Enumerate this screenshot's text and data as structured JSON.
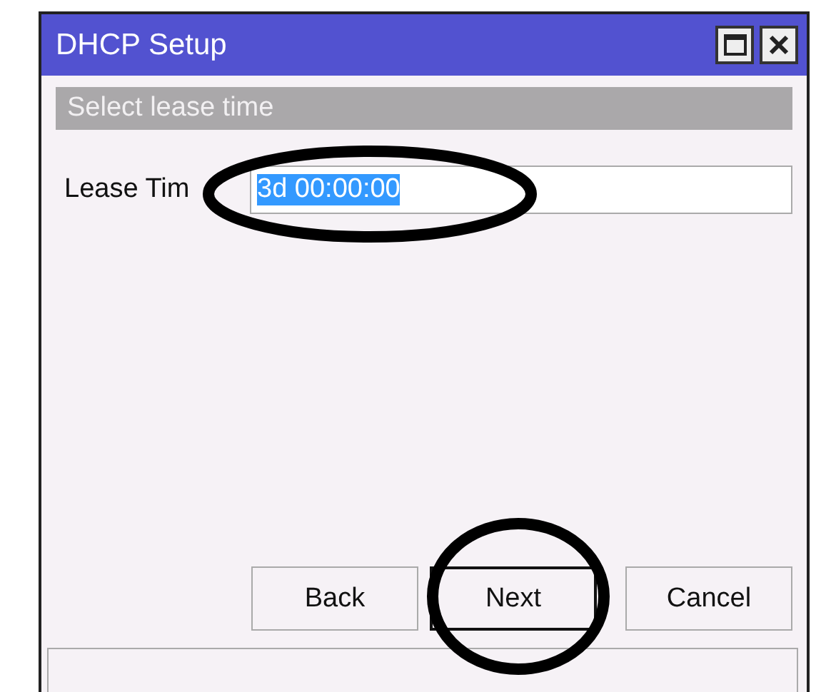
{
  "window": {
    "title": "DHCP Setup"
  },
  "section": {
    "title": "Select lease time"
  },
  "field": {
    "label": "Lease Tim",
    "value": "3d 00:00:00",
    "selected": true
  },
  "buttons": [
    {
      "label": "Back",
      "focused": false
    },
    {
      "label": "Next",
      "focused": true
    },
    {
      "label": "Cancel",
      "focused": false
    }
  ]
}
